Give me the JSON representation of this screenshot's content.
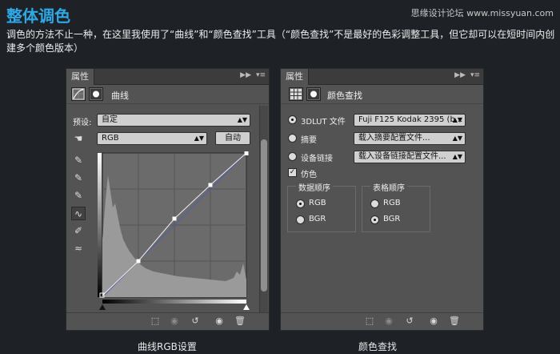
{
  "header": {
    "title": "整体调色",
    "watermark": "思缘设计论坛 www.missyuan.com",
    "intro": "调色的方法不止一种，在这里我使用了“曲线”和“颜色查找”工具（“颜色查找”不是最好的色彩调整工具，但它却可以在短时间内创建多个颜色版本）"
  },
  "curves_panel": {
    "tab": "属性",
    "title": "曲线",
    "preset_label": "预设:",
    "preset_value": "自定",
    "channel_value": "RGB",
    "auto_label": "自动",
    "caption": "曲线RGB设置"
  },
  "lookup_panel": {
    "tab": "属性",
    "title": "颜色查找",
    "lut_label": "3DLUT 文件",
    "lut_value": "Fuji F125 Kodak 2395 (b...",
    "abstract_label": "摘要",
    "abstract_value": "载入摘要配置文件...",
    "device_label": "设备链接",
    "device_value": "载入设备链接配置文件...",
    "dither_label": "仿色",
    "data_order_title": "数据顺序",
    "table_order_title": "表格顺序",
    "rgb": "RGB",
    "bgr": "BGR",
    "caption": "颜色查找"
  },
  "colors": {
    "accent": "#2fa8e6",
    "panel": "#535353",
    "background": "#1e2227"
  }
}
